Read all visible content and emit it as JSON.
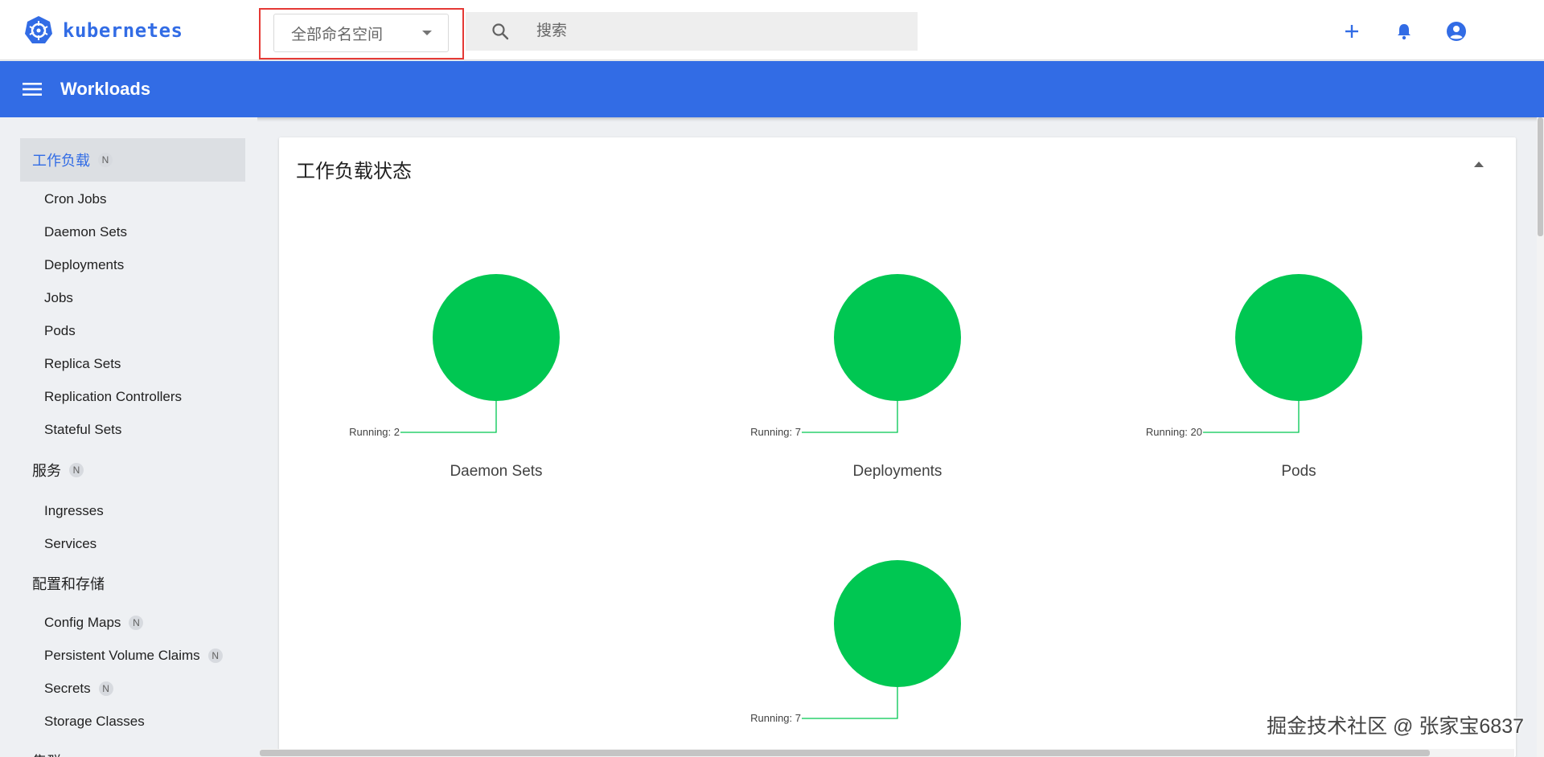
{
  "app": {
    "brand": "kubernetes",
    "namespace_value": "全部命名空间",
    "search_placeholder": "搜索"
  },
  "header": {
    "title": "Workloads"
  },
  "sidebar": {
    "active_label": "工作负载",
    "active_badge": "N",
    "workload_items": [
      "Cron Jobs",
      "Daemon Sets",
      "Deployments",
      "Jobs",
      "Pods",
      "Replica Sets",
      "Replication Controllers",
      "Stateful Sets"
    ],
    "service_section": "服务",
    "service_badge": "N",
    "service_items": [
      "Ingresses",
      "Services"
    ],
    "config_section": "配置和存储",
    "config_items": [
      {
        "label": "Config Maps",
        "badge": "N"
      },
      {
        "label": "Persistent Volume Claims",
        "badge": "N"
      },
      {
        "label": "Secrets",
        "badge": "N"
      },
      {
        "label": "Storage Classes",
        "badge": ""
      }
    ],
    "cluster_section": "集群"
  },
  "card": {
    "title": "工作负载状态"
  },
  "chart_data": [
    {
      "type": "pie",
      "title": "Daemon Sets",
      "slices": [
        {
          "label": "Running: 2",
          "value": 2,
          "color": "#00c752"
        }
      ]
    },
    {
      "type": "pie",
      "title": "Deployments",
      "slices": [
        {
          "label": "Running: 7",
          "value": 7,
          "color": "#00c752"
        }
      ]
    },
    {
      "type": "pie",
      "title": "Pods",
      "slices": [
        {
          "label": "Running: 20",
          "value": 20,
          "color": "#00c752"
        }
      ]
    },
    {
      "type": "pie",
      "title": "",
      "slices": [
        {
          "label": "Running: 7",
          "value": 7,
          "color": "#00c752"
        }
      ]
    }
  ],
  "watermark": "掘金技术社区 @ 张家宝6837",
  "colors": {
    "primary": "#326ce5",
    "running": "#00c752",
    "highlight": "#e53935"
  }
}
